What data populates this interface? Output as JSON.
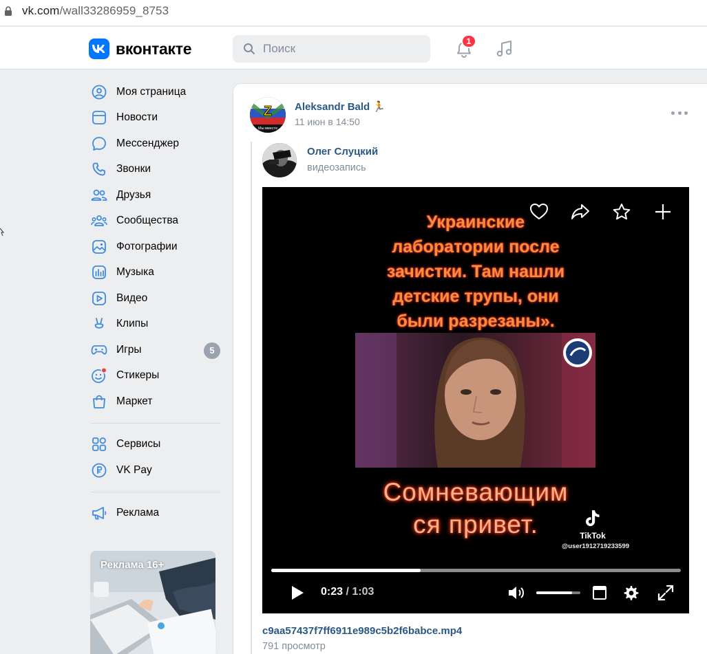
{
  "browser": {
    "url_host": "vk.com",
    "url_path": "/wall33286959_8753"
  },
  "header": {
    "logo_text": "вконтакте",
    "search_placeholder": "Поиск",
    "notifications_count": "1",
    "accent_color": "#0077ff"
  },
  "sidebar": {
    "items": [
      {
        "label": "Моя страница",
        "icon": "user-circle-icon"
      },
      {
        "label": "Новости",
        "icon": "news-icon"
      },
      {
        "label": "Мессенджер",
        "icon": "message-icon"
      },
      {
        "label": "Звонки",
        "icon": "phone-icon"
      },
      {
        "label": "Друзья",
        "icon": "friends-icon"
      },
      {
        "label": "Сообщества",
        "icon": "communities-icon"
      },
      {
        "label": "Фотографии",
        "icon": "photos-icon"
      },
      {
        "label": "Музыка",
        "icon": "music-icon"
      },
      {
        "label": "Видео",
        "icon": "video-icon"
      },
      {
        "label": "Клипы",
        "icon": "clips-icon"
      },
      {
        "label": "Игры",
        "icon": "games-icon",
        "count": "5"
      },
      {
        "label": "Стикеры",
        "icon": "stickers-icon"
      },
      {
        "label": "Маркет",
        "icon": "market-icon"
      }
    ],
    "services": [
      {
        "label": "Сервисы",
        "icon": "services-icon"
      },
      {
        "label": "VK Pay",
        "icon": "vkpay-icon"
      }
    ],
    "ads_link": {
      "label": "Реклама",
      "icon": "megaphone-icon"
    },
    "ad_banner_label": "Реклама 16+"
  },
  "post": {
    "author": "Aleksandr Bald",
    "author_emoji": "🏃",
    "time": "11 июн в 14:50",
    "repost": {
      "author": "Олег Слуцкий",
      "subtitle": "видеозапись"
    },
    "video": {
      "caption_top": [
        "Украинские",
        "лаборатории после",
        "зачистки. Там  нашли",
        "детские трупы, они",
        "были разрезаны»."
      ],
      "caption_bottom": [
        "Сомневающим",
        "ся привет."
      ],
      "watermark_name": "TikTok",
      "watermark_user": "@user1912719233599",
      "current_time": "0:23",
      "separator": "/",
      "total_time": "1:03",
      "progress": 0.365,
      "volume": 0.82
    },
    "file_name": "c9aa57437f7ff6911e989c5b2f6babce.mp4",
    "views": "791 просмотр"
  }
}
